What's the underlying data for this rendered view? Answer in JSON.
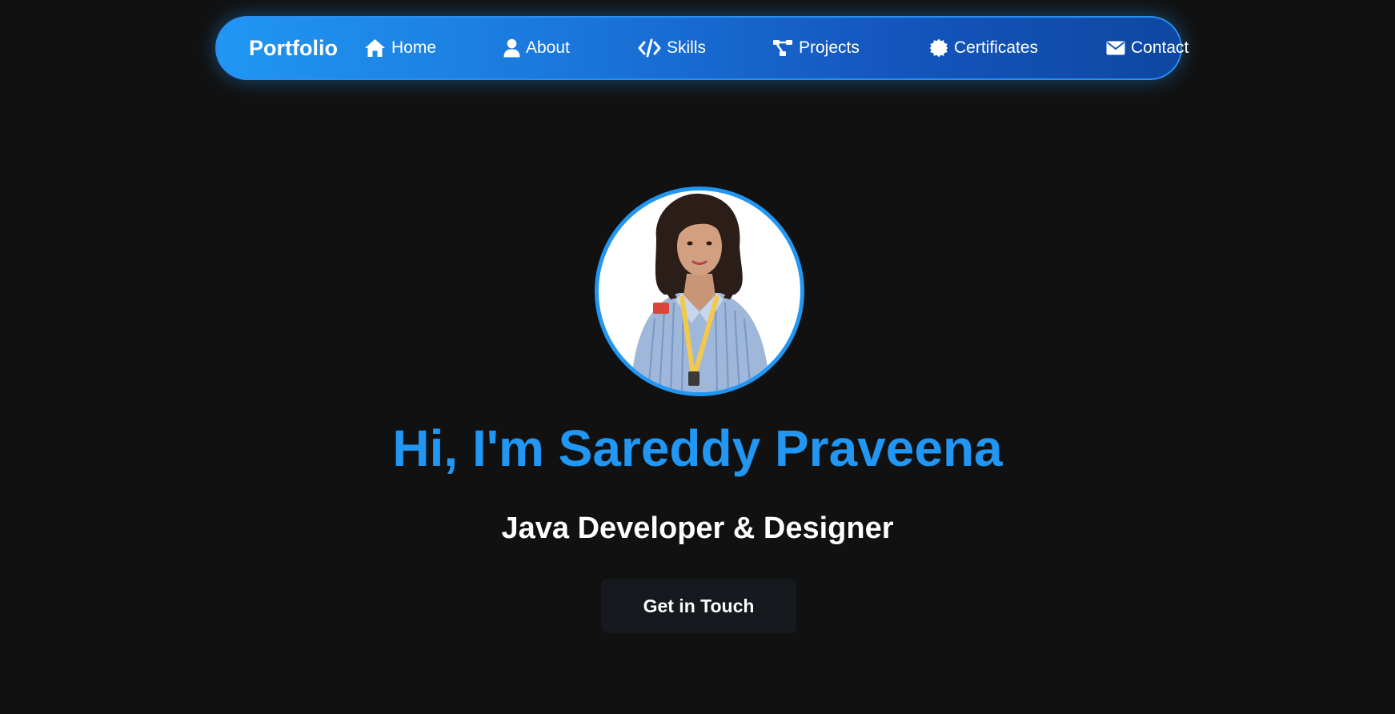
{
  "navbar": {
    "brand": "Portfolio",
    "items": [
      {
        "label": "Home",
        "icon": "home-icon"
      },
      {
        "label": "About",
        "icon": "user-icon"
      },
      {
        "label": "Skills",
        "icon": "code-icon"
      },
      {
        "label": "Projects",
        "icon": "project-diagram-icon"
      },
      {
        "label": "Certificates",
        "icon": "certificate-icon"
      },
      {
        "label": "Contact",
        "icon": "envelope-icon"
      }
    ]
  },
  "hero": {
    "title": "Hi, I'm Sareddy Praveena",
    "subtitle": "Java Developer & Designer",
    "cta_label": "Get in Touch"
  },
  "colors": {
    "background": "#111111",
    "accent": "#2196f3",
    "nav_gradient_start": "#2196f3",
    "nav_gradient_end": "#0d47a1",
    "button_bg": "#16191d"
  }
}
